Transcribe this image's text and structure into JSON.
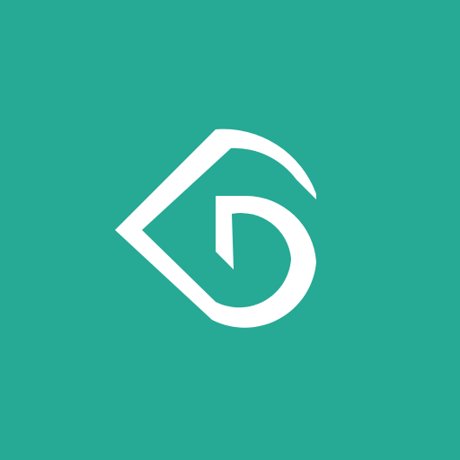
{
  "app": {
    "icon_name": "gofundme-heart-g-logo-icon"
  },
  "colors": {
    "background": "#26A995",
    "mark": "#FFFFFF"
  }
}
